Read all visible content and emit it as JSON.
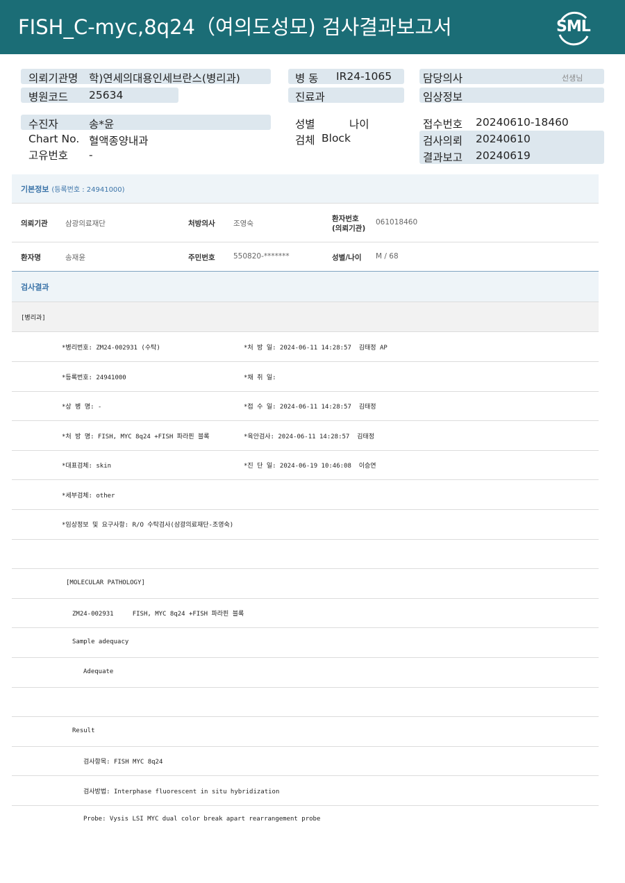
{
  "header": {
    "title": "FISH_C-myc,8q24（여의도성모) 검사결과보고서",
    "logo_text": "SML"
  },
  "top": {
    "institution_label": "의뢰기관명",
    "institution_value": "학)연세의대용인세브란스(병리과)",
    "ward_label": "병  동",
    "ward_value": "IR24-1065",
    "doctor_label": "담당의사",
    "doctor_suffix": "선생님",
    "hospital_code_label": "병원코드",
    "hospital_code_value": "25634",
    "dept_label": "진료과",
    "clinical_info_label": "임상정보",
    "patient_label": "수진자",
    "patient_value": "송*윤",
    "sex_label": "성별",
    "age_label": "나이",
    "receipt_label": "접수번호",
    "receipt_value": "20240610-18460",
    "chart_label": "Chart No.",
    "chart_value": "혈액종양내과",
    "specimen_label": "검체",
    "specimen_value": "Block",
    "request_label": "검사의뢰",
    "request_value": "20240610",
    "unique_label": "고유번호",
    "unique_value": "-",
    "report_label": "결과보고",
    "report_value": "20240619"
  },
  "basic": {
    "title": "기본정보",
    "reg": "(등록번호 : 24941000)",
    "inst_label": "의뢰기관",
    "inst_value": "삼광의료재단",
    "prescriber_label": "처방의사",
    "prescriber_value": "조영숙",
    "ptno_label_1": "환자번호",
    "ptno_label_2": "(의뢰기관)",
    "ptno_value": "061018460",
    "name_label": "환자명",
    "name_value": "송재윤",
    "rrn_label": "주민번호",
    "rrn_value": "550820-*******",
    "sexage_label": "성별/나이",
    "sexage_value": "M / 68"
  },
  "results": {
    "title": "검사결과",
    "subhead": "[병리과]",
    "lines": {
      "l1a": "*병리번호: ZM24-002931 (수탁)",
      "l1b": "*처 방 일: 2024-06-11 14:28:57  김태정 AP",
      "l2a": "*등록번호: 24941000",
      "l2b": "*채 취 일:",
      "l3a": "*상 병 명: -",
      "l3b": "*접 수 일: 2024-06-11 14:28:57  김태정",
      "l4a": "*처 방 명: FISH, MYC 8q24 +FISH 파라핀 블록",
      "l4b": "*육안검사: 2024-06-11 14:28:57  김태정",
      "l5a": "*대표검체: skin",
      "l5b": "*진 단 일: 2024-06-19 10:46:08  이승연",
      "l6": "*세부검체: other",
      "l7": "*임상정보 및 요구사항: R/O 수탁검사(삼광의료재단-조영숙)",
      "mp": "[MOLECULAR PATHOLOGY]",
      "m1": "ZM24-002931     FISH, MYC 8q24 +FISH 파라핀 블록",
      "m2": "Sample adequacy",
      "m3": "Adequate",
      "m4": "Result",
      "m5": "검사항목: FISH MYC 8q24",
      "m6": "검사방법: Interphase fluorescent in situ hybridization",
      "m7": "Probe: Vysis LSI MYC dual color break apart rearrangement probe"
    }
  },
  "colors": {
    "header": "#1b6d76",
    "pill": "#dde7ee",
    "section": "#eef4f8",
    "accent": "#3a73a8"
  }
}
